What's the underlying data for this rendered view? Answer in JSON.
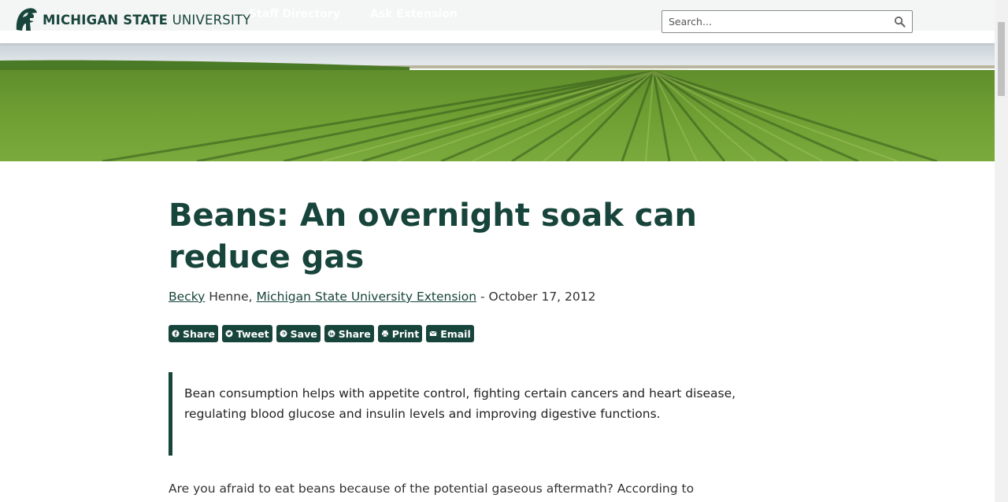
{
  "header": {
    "logo_bold": "MICHIGAN STATE",
    "logo_light": "UNIVERSITY",
    "nav_items": [
      "Staff Directory",
      "Ask Extension"
    ],
    "search_placeholder": "Search...",
    "search_icon": "magnifier-icon"
  },
  "hero": {
    "image": "soybean-field-rows"
  },
  "article": {
    "title": "Beans: An overnight soak can reduce gas",
    "author_first": "Becky",
    "author_last": " Henne, ",
    "organization": "Michigan State University Extension",
    "date": " - October 17, 2012",
    "share_buttons": [
      {
        "label": "Share",
        "icon": "facebook-icon"
      },
      {
        "label": "Tweet",
        "icon": "twitter-icon"
      },
      {
        "label": "Save",
        "icon": "pinterest-icon"
      },
      {
        "label": "Share",
        "icon": "linkedin-icon"
      },
      {
        "label": "Print",
        "icon": "print-icon"
      },
      {
        "label": "Email",
        "icon": "email-icon"
      }
    ],
    "summary": "Bean consumption helps with appetite control, fighting certain cancers and heart disease, regulating blood glucose and insulin levels and improving digestive functions.",
    "body_first_line": "Are you afraid to eat beans because of the potential gaseous aftermath? According to"
  },
  "colors": {
    "brand": "#18453b",
    "text": "#222222"
  }
}
